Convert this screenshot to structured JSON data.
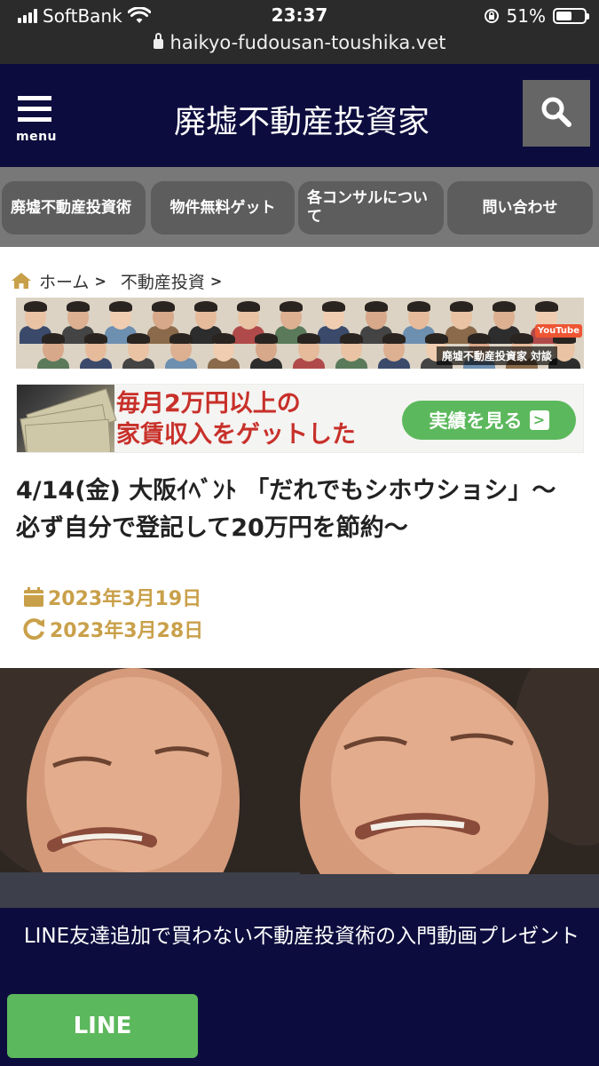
{
  "status_bar": {
    "carrier": "SoftBank",
    "time": "23:37",
    "battery": "51%",
    "battery_level": 0.51,
    "url": "haikyo-fudousan-toushika.vet"
  },
  "header": {
    "menu_label": "menu",
    "site_title": "廃墟不動産投資家",
    "search_icon": "search-icon",
    "background": "#0c0c3e"
  },
  "nav": {
    "items": [
      {
        "label": "廃墟不動産投資術"
      },
      {
        "label": "物件無料ゲット"
      },
      {
        "label": "各コンサルについて"
      },
      {
        "label": "問い合わせ"
      }
    ]
  },
  "breadcrumb": {
    "home": "ホーム",
    "category": "不動産投資",
    "separator": ">"
  },
  "banners": {
    "people_caption": "廃墟不動産投資家 対談",
    "youtube_label": "YouTube",
    "income_line1": "毎月2万円以上の",
    "income_line2": "家賃収入をゲットした",
    "income_button": "実績を見る",
    "income_button_arrow": ">"
  },
  "article": {
    "title": "4/14(金) 大阪ｲﾍﾞﾝﾄ 「だれでもシホウショシ」〜必ず自分で登記して20万円を節約〜",
    "published": "2023年3月19日",
    "updated": "2023年3月28日",
    "date_color": "#c9a04a"
  },
  "line_panel": {
    "text": "LINE友達追加で買わない不動産投資術の入門動画プレゼント",
    "button": "LINE",
    "button_color": "#5cb85c"
  }
}
